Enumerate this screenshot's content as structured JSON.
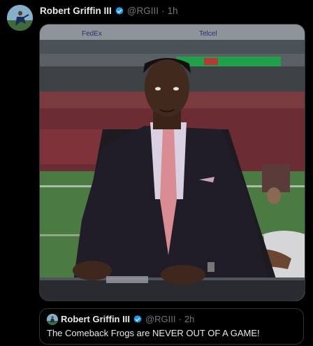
{
  "tweet": {
    "author_name": "Robert Griffin III",
    "handle": "@RGIII",
    "separator": "·",
    "time": "1h",
    "avatar_icon": "profile-photo",
    "verified_icon": "verified-badge-icon",
    "accent_color": "#1d9bf0"
  },
  "media": {
    "type": "video-still",
    "stadium_sign_left": "FedEx",
    "stadium_sign_right": "Telcel"
  },
  "quote": {
    "author_name": "Robert Griffin III",
    "handle": "@RGIII",
    "separator": "·",
    "time": "2h",
    "text": "The Comeback Frogs are NEVER OUT OF A GAME!"
  }
}
